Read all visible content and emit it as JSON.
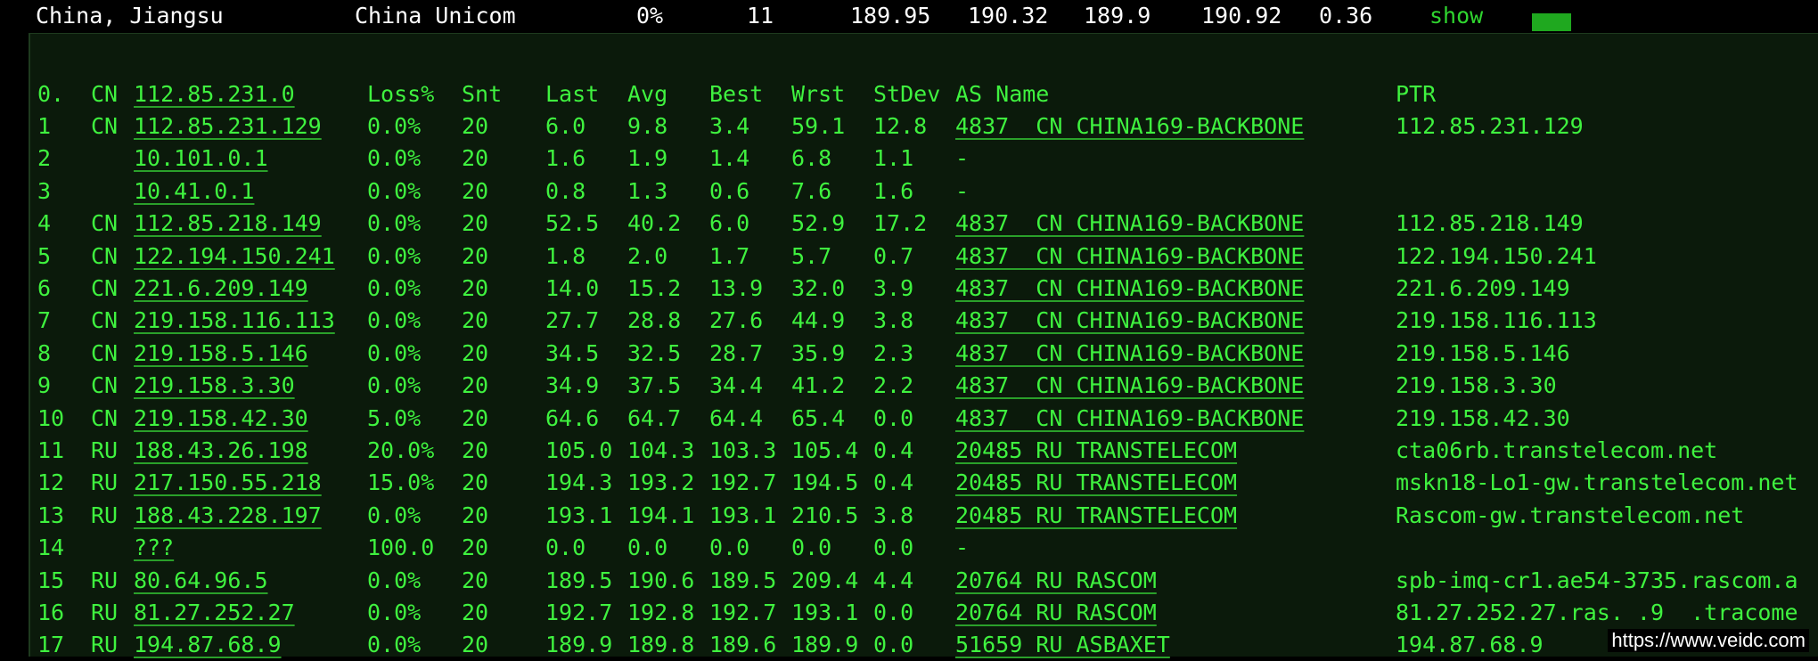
{
  "summary": {
    "location": "China, Jiangsu",
    "isp": "China Unicom",
    "loss": "0%",
    "sent": "11",
    "last": "189.95",
    "avg": "190.32",
    "best": "189.9",
    "worst": "190.92",
    "stdev": "0.36",
    "show_label": "show"
  },
  "header": {
    "idx": "0.",
    "cc": "CN",
    "host": "112.85.231.0",
    "loss": "Loss%",
    "snt": "Snt",
    "last": "Last",
    "avg": "Avg",
    "best": "Best",
    "wrst": "Wrst",
    "stdev": "StDev",
    "asname": "AS Name",
    "ptr": "PTR"
  },
  "hops": [
    {
      "idx": "1",
      "cc": "CN",
      "host": "112.85.231.129",
      "loss": "0.0%",
      "snt": "20",
      "last": "6.0",
      "avg": "9.8",
      "best": "3.4",
      "wrst": "59.1",
      "stdev": "12.8",
      "asname": "4837  CN CHINA169-BACKBONE",
      "ptr": "112.85.231.129"
    },
    {
      "idx": "2",
      "cc": "",
      "host": "10.101.0.1",
      "loss": "0.0%",
      "snt": "20",
      "last": "1.6",
      "avg": "1.9",
      "best": "1.4",
      "wrst": "6.8",
      "stdev": "1.1",
      "asname": "-",
      "ptr": ""
    },
    {
      "idx": "3",
      "cc": "",
      "host": "10.41.0.1",
      "loss": "0.0%",
      "snt": "20",
      "last": "0.8",
      "avg": "1.3",
      "best": "0.6",
      "wrst": "7.6",
      "stdev": "1.6",
      "asname": "-",
      "ptr": ""
    },
    {
      "idx": "4",
      "cc": "CN",
      "host": "112.85.218.149",
      "loss": "0.0%",
      "snt": "20",
      "last": "52.5",
      "avg": "40.2",
      "best": "6.0",
      "wrst": "52.9",
      "stdev": "17.2",
      "asname": "4837  CN CHINA169-BACKBONE",
      "ptr": "112.85.218.149"
    },
    {
      "idx": "5",
      "cc": "CN",
      "host": "122.194.150.241",
      "loss": "0.0%",
      "snt": "20",
      "last": "1.8",
      "avg": "2.0",
      "best": "1.7",
      "wrst": "5.7",
      "stdev": "0.7",
      "asname": "4837  CN CHINA169-BACKBONE",
      "ptr": "122.194.150.241"
    },
    {
      "idx": "6",
      "cc": "CN",
      "host": "221.6.209.149",
      "loss": "0.0%",
      "snt": "20",
      "last": "14.0",
      "avg": "15.2",
      "best": "13.9",
      "wrst": "32.0",
      "stdev": "3.9",
      "asname": "4837  CN CHINA169-BACKBONE",
      "ptr": "221.6.209.149"
    },
    {
      "idx": "7",
      "cc": "CN",
      "host": "219.158.116.113",
      "loss": "0.0%",
      "snt": "20",
      "last": "27.7",
      "avg": "28.8",
      "best": "27.6",
      "wrst": "44.9",
      "stdev": "3.8",
      "asname": "4837  CN CHINA169-BACKBONE",
      "ptr": "219.158.116.113"
    },
    {
      "idx": "8",
      "cc": "CN",
      "host": "219.158.5.146",
      "loss": "0.0%",
      "snt": "20",
      "last": "34.5",
      "avg": "32.5",
      "best": "28.7",
      "wrst": "35.9",
      "stdev": "2.3",
      "asname": "4837  CN CHINA169-BACKBONE",
      "ptr": "219.158.5.146"
    },
    {
      "idx": "9",
      "cc": "CN",
      "host": "219.158.3.30",
      "loss": "0.0%",
      "snt": "20",
      "last": "34.9",
      "avg": "37.5",
      "best": "34.4",
      "wrst": "41.2",
      "stdev": "2.2",
      "asname": "4837  CN CHINA169-BACKBONE",
      "ptr": "219.158.3.30"
    },
    {
      "idx": "10",
      "cc": "CN",
      "host": "219.158.42.30",
      "loss": "5.0%",
      "snt": "20",
      "last": "64.6",
      "avg": "64.7",
      "best": "64.4",
      "wrst": "65.4",
      "stdev": "0.0",
      "asname": "4837  CN CHINA169-BACKBONE",
      "ptr": "219.158.42.30"
    },
    {
      "idx": "11",
      "cc": "RU",
      "host": "188.43.26.198",
      "loss": "20.0%",
      "snt": "20",
      "last": "105.0",
      "avg": "104.3",
      "best": "103.3",
      "wrst": "105.4",
      "stdev": "0.4",
      "asname": "20485 RU TRANSTELECOM",
      "ptr": "cta06rb.transtelecom.net"
    },
    {
      "idx": "12",
      "cc": "RU",
      "host": "217.150.55.218",
      "loss": "15.0%",
      "snt": "20",
      "last": "194.3",
      "avg": "193.2",
      "best": "192.7",
      "wrst": "194.5",
      "stdev": "0.4",
      "asname": "20485 RU TRANSTELECOM",
      "ptr": "mskn18-Lo1-gw.transtelecom.net"
    },
    {
      "idx": "13",
      "cc": "RU",
      "host": "188.43.228.197",
      "loss": "0.0%",
      "snt": "20",
      "last": "193.1",
      "avg": "194.1",
      "best": "193.1",
      "wrst": "210.5",
      "stdev": "3.8",
      "asname": "20485 RU TRANSTELECOM",
      "ptr": "Rascom-gw.transtelecom.net"
    },
    {
      "idx": "14",
      "cc": "",
      "host": "???",
      "loss": "100.0",
      "snt": "20",
      "last": "0.0",
      "avg": "0.0",
      "best": "0.0",
      "wrst": "0.0",
      "stdev": "0.0",
      "asname": "-",
      "ptr": ""
    },
    {
      "idx": "15",
      "cc": "RU",
      "host": "80.64.96.5",
      "loss": "0.0%",
      "snt": "20",
      "last": "189.5",
      "avg": "190.6",
      "best": "189.5",
      "wrst": "209.4",
      "stdev": "4.4",
      "asname": "20764 RU RASCOM",
      "ptr": "spb-imq-cr1.ae54-3735.rascom.a"
    },
    {
      "idx": "16",
      "cc": "RU",
      "host": "81.27.252.27",
      "loss": "0.0%",
      "snt": "20",
      "last": "192.7",
      "avg": "192.8",
      "best": "192.7",
      "wrst": "193.1",
      "stdev": "0.0",
      "asname": "20764 RU RASCOM",
      "ptr": "81.27.252.27.ras. .9  .tracome"
    },
    {
      "idx": "17",
      "cc": "RU",
      "host": "194.87.68.9",
      "loss": "0.0%",
      "snt": "20",
      "last": "189.9",
      "avg": "189.8",
      "best": "189.6",
      "wrst": "189.9",
      "stdev": "0.0",
      "asname": "51659 RU ASBAXET",
      "ptr": "194.87.68.9"
    }
  ],
  "watermark": "https://www.veidc.com",
  "colors": {
    "text": "#3ff23f",
    "panel_bg": "#0b1a0b",
    "header_bg": "#000000",
    "show": "#2fd52f",
    "indicator": "#1fa81f"
  }
}
